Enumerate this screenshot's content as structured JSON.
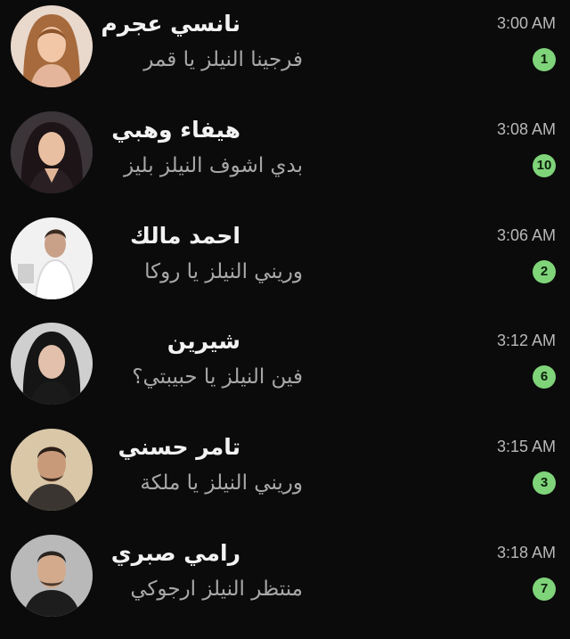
{
  "colors": {
    "background": "#0b0b0b",
    "name_text": "#f2f2f2",
    "message_text": "#a8a8a8",
    "time_text": "#b8b8b8",
    "badge": "#7fd47a"
  },
  "chats": [
    {
      "name": "نانسي عجرم",
      "message": "فرجينا النيلز يا قمر",
      "time": "3:00 AM",
      "unread": "1"
    },
    {
      "name": "هيفاء وهبي",
      "message": "بدي اشوف النيلز بليز",
      "time": "3:08 AM",
      "unread": "10"
    },
    {
      "name": "احمد مالك",
      "message": "وريني النيلز يا روكا",
      "time": "3:06 AM",
      "unread": "2"
    },
    {
      "name": "شيرين",
      "message": "فين النيلز يا حبيبتي؟",
      "time": "3:12 AM",
      "unread": "6"
    },
    {
      "name": "تامر حسني",
      "message": "وريني النيلز يا ملكة",
      "time": "3:15 AM",
      "unread": "3"
    },
    {
      "name": "رامي صبري",
      "message": "منتظر النيلز ارجوكي",
      "time": "3:18 AM",
      "unread": "7"
    }
  ]
}
